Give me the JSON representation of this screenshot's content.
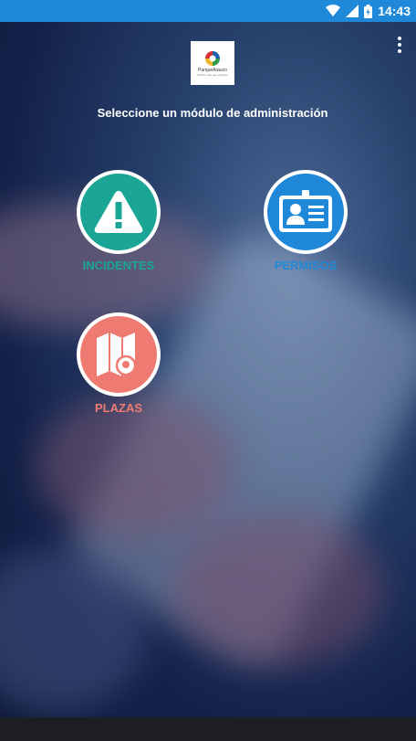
{
  "status_bar": {
    "time": "14:43",
    "icons": [
      "wifi-icon",
      "signal-icon",
      "battery-icon"
    ]
  },
  "logo": {
    "brand_text": "ParqueArauco",
    "tagline": "Mucho más que comprar"
  },
  "heading": "Seleccione un módulo de administración",
  "modules": [
    {
      "label": "INCIDENTES",
      "icon": "warning-icon",
      "color": "#1aa595"
    },
    {
      "label": "PERMISOS",
      "icon": "id-card-icon",
      "color": "#1f88d8"
    },
    {
      "label": "PLAZAS",
      "icon": "map-pin-icon",
      "color": "#ef7a72"
    }
  ],
  "colors": {
    "status_bar": "#1f88d8",
    "background": "#14224a",
    "nav_bar": "#1c1e23"
  }
}
